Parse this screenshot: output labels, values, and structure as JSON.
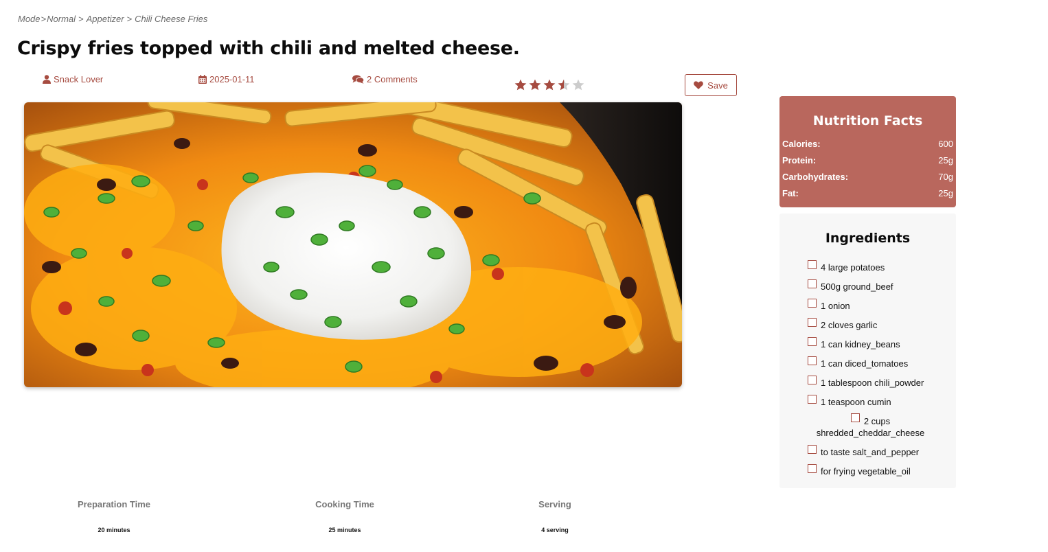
{
  "breadcrumb": {
    "items": [
      "Mode",
      "Normal",
      "Appetizer",
      "Chili Cheese Fries"
    ]
  },
  "title": "Crispy fries topped with chili and melted cheese.",
  "meta": {
    "author": "Snack Lover",
    "date": "2025-01-11",
    "comments": "2 Comments",
    "rating": 3.5,
    "rating_max": 5
  },
  "save_label": "Save",
  "stats": [
    {
      "label": "Preparation Time",
      "value": "20 minutes"
    },
    {
      "label": "Cooking Time",
      "value": "25 minutes"
    },
    {
      "label": "Serving",
      "value": "4 serving"
    }
  ],
  "nutrition": {
    "title": "Nutrition Facts",
    "rows": [
      {
        "label": "Calories:",
        "value": "600"
      },
      {
        "label": "Protein:",
        "value": "25g"
      },
      {
        "label": "Carbohydrates:",
        "value": "70g"
      },
      {
        "label": "Fat:",
        "value": "25g"
      }
    ]
  },
  "ingredients": {
    "title": "Ingredients",
    "items": [
      "4 large potatoes",
      "500g ground_beef",
      "1 onion",
      "2 cloves garlic",
      "1 can kidney_beans",
      "1 can diced_tomatoes",
      "1 tablespoon chili_powder",
      "1 teaspoon cumin",
      "2 cups shredded_cheddar_cheese",
      "to taste salt_and_pepper",
      "for frying vegetable_oil"
    ]
  },
  "colors": {
    "accent": "#a64b40",
    "nutrition_bg": "#b9675d",
    "star_filled": "#a64b40",
    "star_empty": "#cccccc"
  },
  "icons": [
    "user-icon",
    "calendar-icon",
    "comments-icon",
    "star-icon",
    "heart-icon"
  ]
}
